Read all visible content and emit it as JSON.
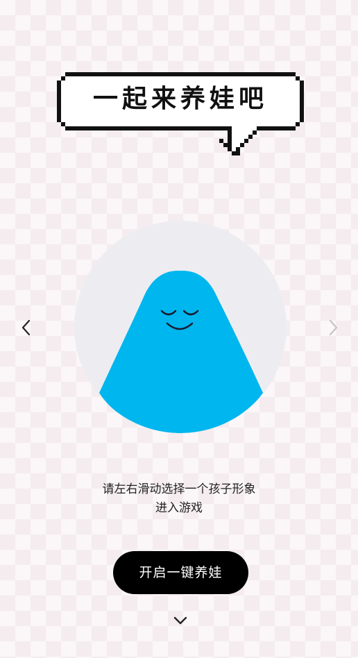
{
  "banner": {
    "title": "一起来养娃吧",
    "icon": "pixel-speech-bubble-icon"
  },
  "carousel": {
    "character_name": "blue-blob-character",
    "character_color": "#00b6ee",
    "stage_color": "#ededf1",
    "prev_icon": "chevron-left-icon",
    "next_icon": "chevron-right-icon"
  },
  "instructions": {
    "line1": "请左右滑动选择一个孩子形象",
    "line2": "进入游戏"
  },
  "actions": {
    "start_label": "开启一键养娃",
    "scroll_icon": "chevron-down-icon"
  }
}
